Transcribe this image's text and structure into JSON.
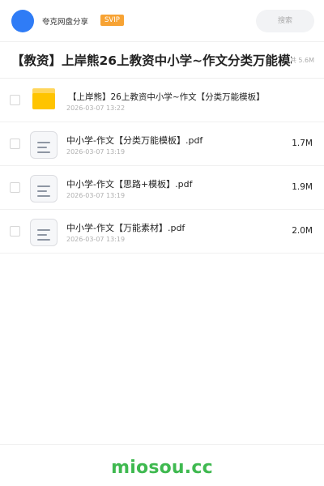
{
  "header": {
    "user_name": "夸克网盘分享",
    "badge": "SVIP",
    "search_placeholder": "搜索"
  },
  "share": {
    "title": "【教资】上岸熊26上教资中小学~作文分类万能模板",
    "total_size": "共 5.6M"
  },
  "files": [
    {
      "type": "folder",
      "name": "【上岸熊】26上教资中小学~作文【分类万能模板】",
      "date": "2026-03-07 13:22",
      "size": ""
    },
    {
      "type": "pdf",
      "name": "中小学-作文【分类万能模板】.pdf",
      "date": "2026-03-07 13:19",
      "size": "1.7M"
    },
    {
      "type": "pdf",
      "name": "中小学-作文【思路+模板】.pdf",
      "date": "2026-03-07 13:19",
      "size": "1.9M"
    },
    {
      "type": "pdf",
      "name": "中小学-作文【万能素材】.pdf",
      "date": "2026-03-07 13:19",
      "size": "2.0M"
    }
  ],
  "footer": {
    "watermark": "miosou.cc"
  },
  "colors": {
    "avatar": "#2f7cf6",
    "badge": "#f7a334",
    "folder": "#ffc400",
    "watermark": "#3fb950"
  }
}
